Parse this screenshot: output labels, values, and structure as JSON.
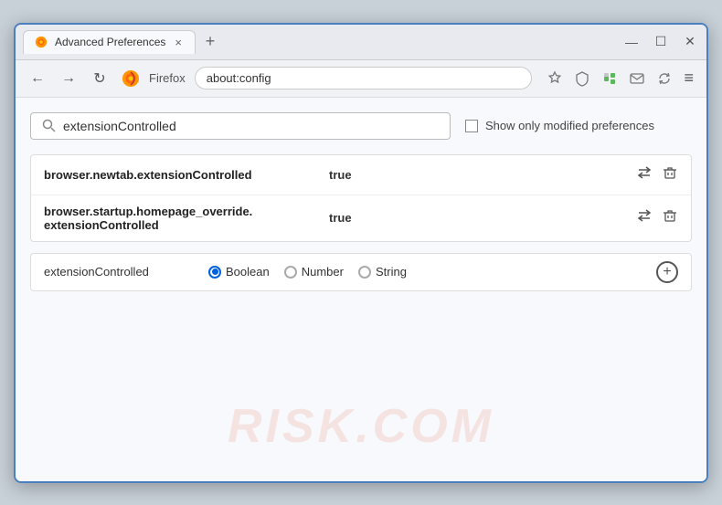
{
  "window": {
    "title": "Advanced Preferences",
    "tab_close": "×",
    "new_tab": "+",
    "win_minimize": "—",
    "win_restore": "☐",
    "win_close": "✕"
  },
  "nav": {
    "back": "←",
    "forward": "→",
    "refresh": "↻",
    "browser_name": "Firefox",
    "address": "about:config",
    "bookmark": "☆",
    "shield": "🛡",
    "ext_icon": "🧩",
    "mail_icon": "✉",
    "sync_icon": "⟳",
    "menu": "≡"
  },
  "search": {
    "placeholder": "extensionControlled",
    "value": "extensionControlled",
    "search_icon": "🔍",
    "show_modified_label": "Show only modified preferences"
  },
  "results": [
    {
      "name": "browser.newtab.extensionControlled",
      "value": "true",
      "swap_icon": "⇄",
      "delete_icon": "🗑"
    },
    {
      "name": "browser.startup.homepage_override.\nextensionControlled",
      "name_line1": "browser.startup.homepage_override.",
      "name_line2": "extensionControlled",
      "value": "true",
      "swap_icon": "⇄",
      "delete_icon": "🗑"
    }
  ],
  "add_preference": {
    "name": "extensionControlled",
    "radio_options": [
      {
        "label": "Boolean",
        "selected": true
      },
      {
        "label": "Number",
        "selected": false
      },
      {
        "label": "String",
        "selected": false
      }
    ],
    "add_label": "+"
  },
  "watermark": {
    "text": "RISK.COM"
  },
  "colors": {
    "accent_blue": "#0060df",
    "border_blue": "#4a7fc0"
  }
}
